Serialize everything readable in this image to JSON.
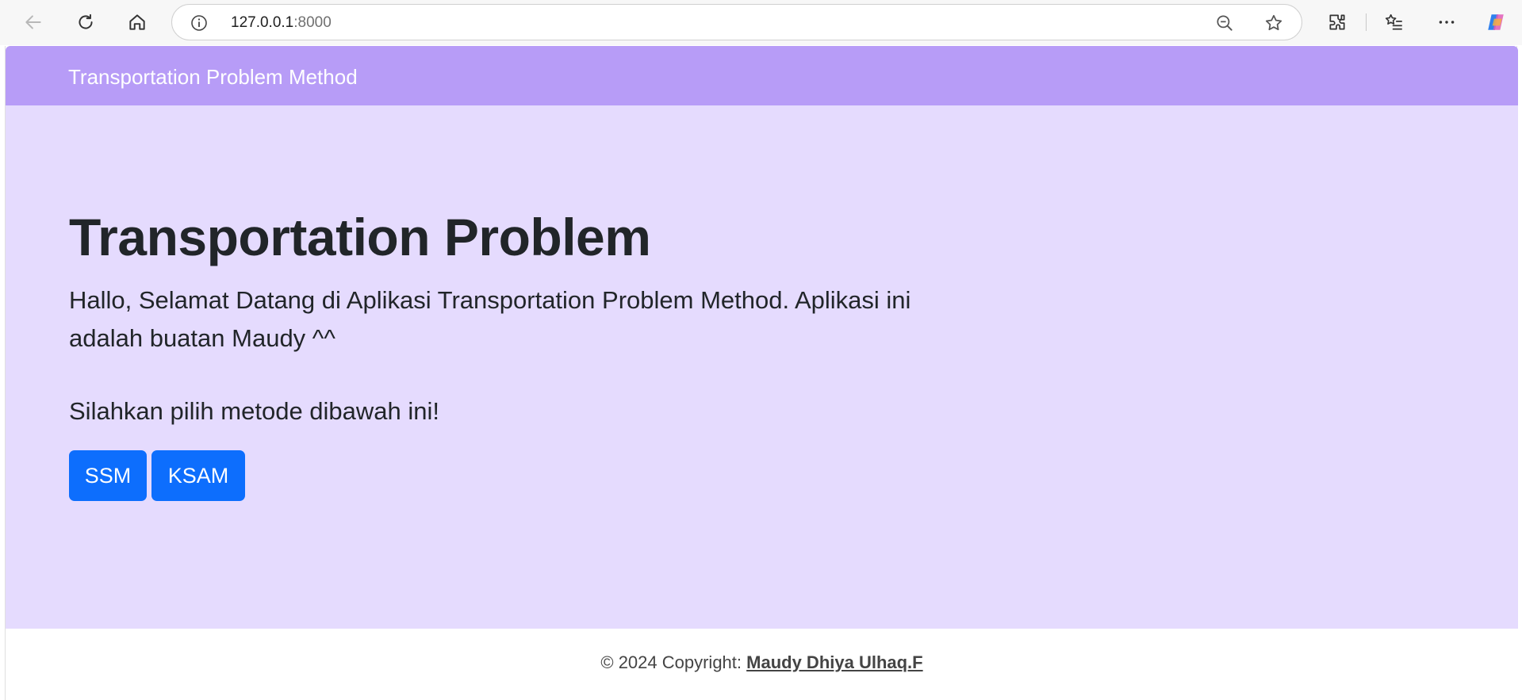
{
  "browser": {
    "url_host": "127.0.0.1",
    "url_port": ":8000",
    "icons": [
      "back-arrow-icon",
      "refresh-icon",
      "home-icon",
      "info-icon",
      "zoom-out-icon",
      "favorite-star-icon",
      "extensions-icon",
      "favorites-list-icon",
      "more-options-icon",
      "copilot-icon"
    ]
  },
  "navbar": {
    "brand": "Transportation Problem Method"
  },
  "hero": {
    "title": "Transportation Problem",
    "lead": "Hallo, Selamat Datang di Aplikasi Transportation Problem Method. Aplikasi ini adalah buatan Maudy ^^",
    "prompt": "Silahkan pilih metode dibawah ini!",
    "buttons": [
      {
        "label": "SSM"
      },
      {
        "label": "KSAM"
      }
    ]
  },
  "footer": {
    "copyright": "© 2024 Copyright: ",
    "author": "Maudy Dhiya Ulhaq.F"
  },
  "colors": {
    "navbar": "#b79cf7",
    "hero": "#e5dbfe",
    "button": "#0d6efd",
    "text": "#212529"
  }
}
